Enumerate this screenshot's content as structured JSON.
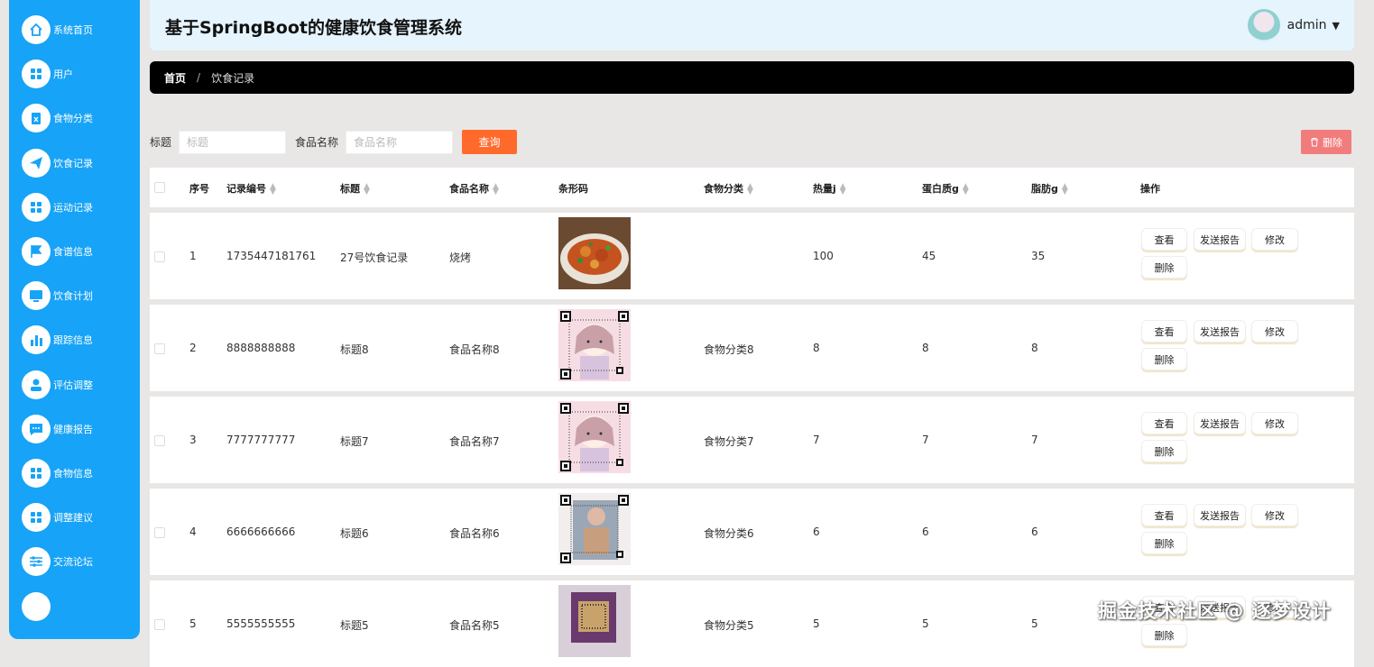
{
  "app": {
    "title": "基于SpringBoot的健康饮食管理系统",
    "user": "admin"
  },
  "sidebar": {
    "items": [
      {
        "label": "系统首页",
        "icon": "home-icon"
      },
      {
        "label": "用户",
        "icon": "grid-icon"
      },
      {
        "label": "食物分类",
        "icon": "clipboard-icon"
      },
      {
        "label": "饮食记录",
        "icon": "paper-plane-icon"
      },
      {
        "label": "运动记录",
        "icon": "grid-icon"
      },
      {
        "label": "食谱信息",
        "icon": "flag-icon"
      },
      {
        "label": "饮食计划",
        "icon": "monitor-icon"
      },
      {
        "label": "跟踪信息",
        "icon": "bar-chart-icon"
      },
      {
        "label": "评估调整",
        "icon": "user-icon"
      },
      {
        "label": "健康报告",
        "icon": "chat-icon"
      },
      {
        "label": "食物信息",
        "icon": "grid-icon"
      },
      {
        "label": "调整建议",
        "icon": "grid-icon"
      },
      {
        "label": "交流论坛",
        "icon": "sliders-icon"
      }
    ]
  },
  "breadcrumb": {
    "home": "首页",
    "separator": "/",
    "current": "饮食记录"
  },
  "search": {
    "title_label": "标题",
    "title_placeholder": "标题",
    "food_label": "食品名称",
    "food_placeholder": "食品名称",
    "query_label": "查询",
    "delete_label": "删除"
  },
  "table": {
    "headers": {
      "index": "序号",
      "record_no": "记录编号",
      "title": "标题",
      "food_name": "食品名称",
      "barcode": "条形码",
      "category": "食物分类",
      "calories": "热量j",
      "protein": "蛋白质g",
      "fat": "脂肪g",
      "actions": "操作"
    },
    "rows": [
      {
        "index": "1",
        "record_no": "1735447181761",
        "title": "27号饮食记录",
        "food_name": "烧烤",
        "category": "",
        "calories": "100",
        "protein": "45",
        "fat": "35",
        "image": "food-photo"
      },
      {
        "index": "2",
        "record_no": "8888888888",
        "title": "标题8",
        "food_name": "食品名称8",
        "category": "食物分类8",
        "calories": "8",
        "protein": "8",
        "fat": "8",
        "image": "qr-code-pink"
      },
      {
        "index": "3",
        "record_no": "7777777777",
        "title": "标题7",
        "food_name": "食品名称7",
        "category": "食物分类7",
        "calories": "7",
        "protein": "7",
        "fat": "7",
        "image": "qr-code-pink"
      },
      {
        "index": "4",
        "record_no": "6666666666",
        "title": "标题6",
        "food_name": "食品名称6",
        "category": "食物分类6",
        "calories": "6",
        "protein": "6",
        "fat": "6",
        "image": "qr-code-photo"
      },
      {
        "index": "5",
        "record_no": "5555555555",
        "title": "标题5",
        "food_name": "食品名称5",
        "category": "食物分类5",
        "calories": "5",
        "protein": "5",
        "fat": "5",
        "image": "qr-code-purple"
      }
    ],
    "actions": {
      "view": "查看",
      "report": "发送报告",
      "edit": "修改",
      "delete": "删除"
    }
  },
  "watermark": "掘金技术社区 @ 逐梦设计",
  "colors": {
    "sidebar": "#17a3f7",
    "query": "#ff6a2c",
    "delete": "#f17c7c",
    "header": "#e5f4fd"
  }
}
